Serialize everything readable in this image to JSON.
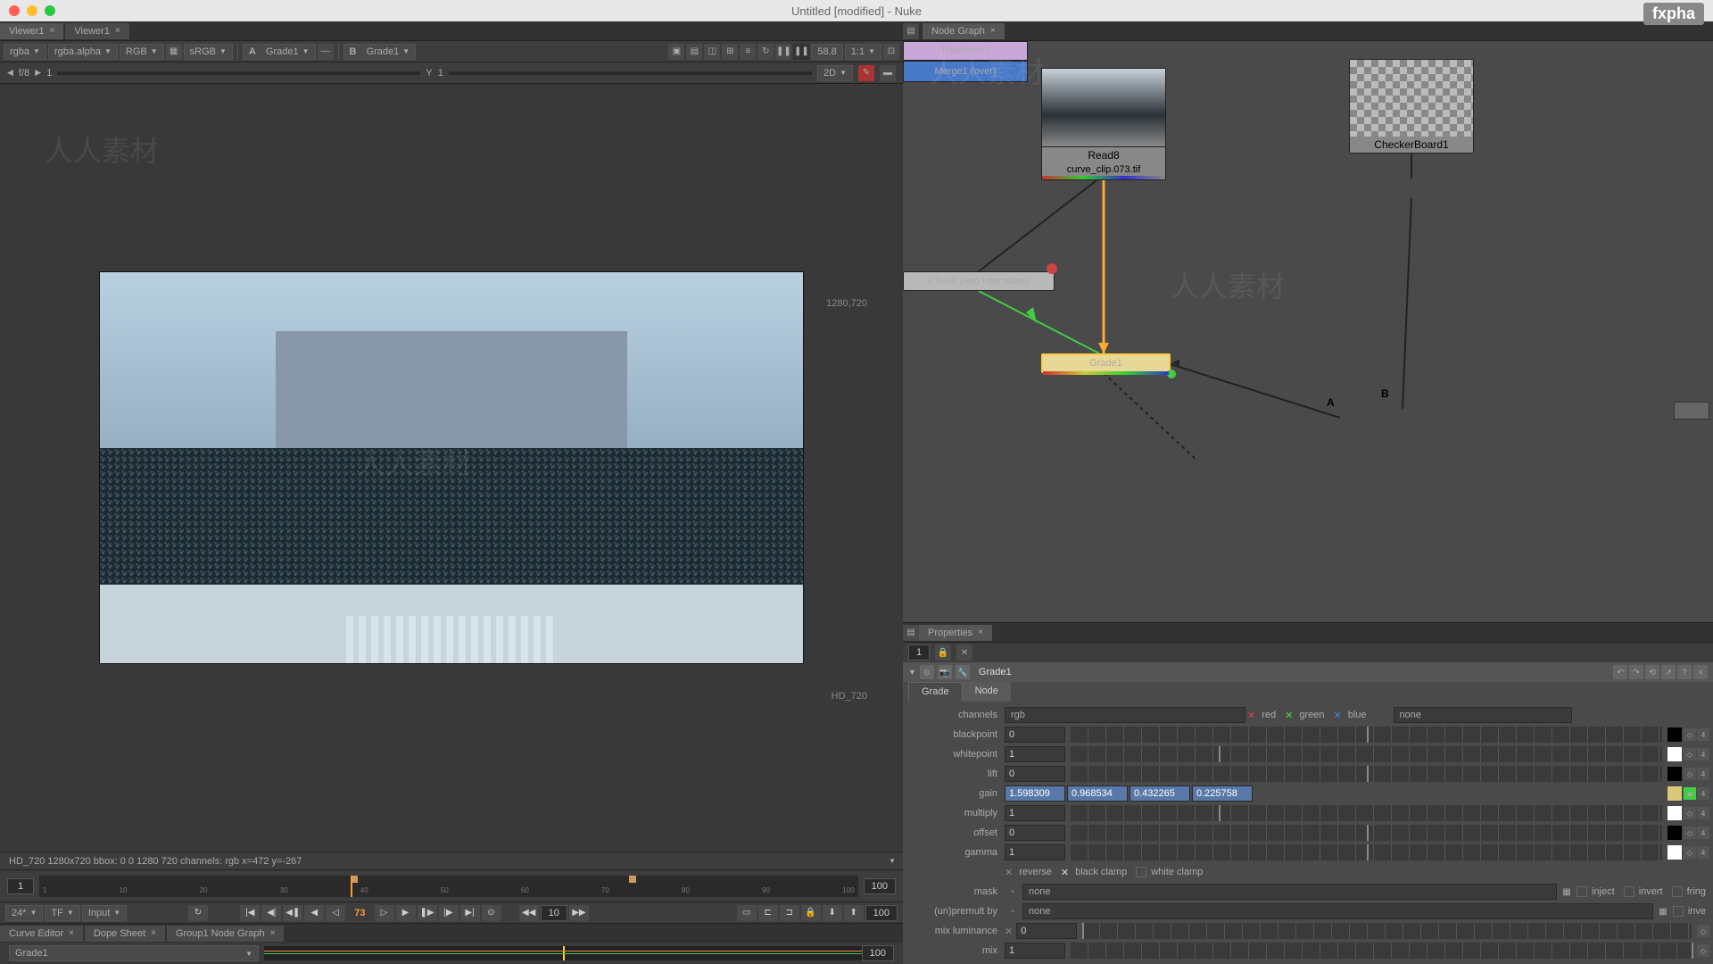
{
  "title": "Untitled [modified] - Nuke",
  "logo": "fxpha",
  "viewer": {
    "tabs": [
      "Viewer1",
      "Viewer1"
    ],
    "channel": "rgba",
    "alpha": "rgba.alpha",
    "color": "RGB",
    "lut": "sRGB",
    "inputA": "Grade1",
    "inputA_prefix": "A",
    "inputB": "Grade1",
    "inputB_prefix": "B",
    "fps": "58.8",
    "zoom": "1:1",
    "view_mode": "2D",
    "fstop": "f/8",
    "gain_val": "1",
    "y_label": "Y",
    "y_val": "1",
    "dim_tr": "1280,720",
    "dim_br": "HD_720",
    "status": "HD_720 1280x720  bbox: 0 0 1280 720 channels: rgb   x=472 y=-267",
    "frame_start": "1",
    "frame_end": "100",
    "current_frame": "73",
    "frame_skip": "10",
    "timeline_ticks": [
      "1",
      "10",
      "20",
      "30",
      "40",
      "50",
      "60",
      "70",
      "80",
      "90",
      "100"
    ],
    "fps_dd": "24*",
    "tf": "TF",
    "input_dd": "Input",
    "end_frame": "100"
  },
  "bottom_tabs": {
    "curve": "Curve Editor",
    "dope": "Dope Sheet",
    "group": "Group1 Node Graph",
    "grade_label": "Grade1"
  },
  "nodegraph": {
    "tab": "Node Graph",
    "read_name": "Read8",
    "read_file": "curve_clip.073.tif",
    "checker": "CheckerBoard1",
    "transform": "Transform1",
    "curvetool": "eTool1 (Avg Intensities)",
    "grade": "Grade1",
    "merge": "Merge1 (over)",
    "port_a": "A",
    "port_b": "B"
  },
  "properties": {
    "tab": "Properties",
    "count": "1",
    "node_name": "Grade1",
    "sub_grade": "Grade",
    "sub_node": "Node",
    "channels_label": "channels",
    "channels_val": "rgb",
    "red": "red",
    "green": "green",
    "blue": "blue",
    "none": "none",
    "blackpoint_label": "blackpoint",
    "blackpoint": "0",
    "whitepoint_label": "whitepoint",
    "whitepoint": "1",
    "lift_label": "lift",
    "lift": "0",
    "gain_label": "gain",
    "gain_r": "1.598309",
    "gain_g": "0.968534",
    "gain_b": "0.432265",
    "gain_a": "0.225758",
    "multiply_label": "multiply",
    "multiply": "1",
    "offset_label": "offset",
    "offset": "0",
    "gamma_label": "gamma",
    "gamma": "1",
    "reverse": "reverse",
    "black_clamp": "black clamp",
    "white_clamp": "white clamp",
    "mask_label": "mask",
    "mask_val": "none",
    "inject": "inject",
    "invert": "invert",
    "fringe": "fring",
    "unpremult_label": "(un)premult by",
    "unpremult_val": "none",
    "inve": "inve",
    "mixlum_label": "mix luminance",
    "mixlum": "0",
    "mix_label": "mix",
    "mix": "1"
  }
}
